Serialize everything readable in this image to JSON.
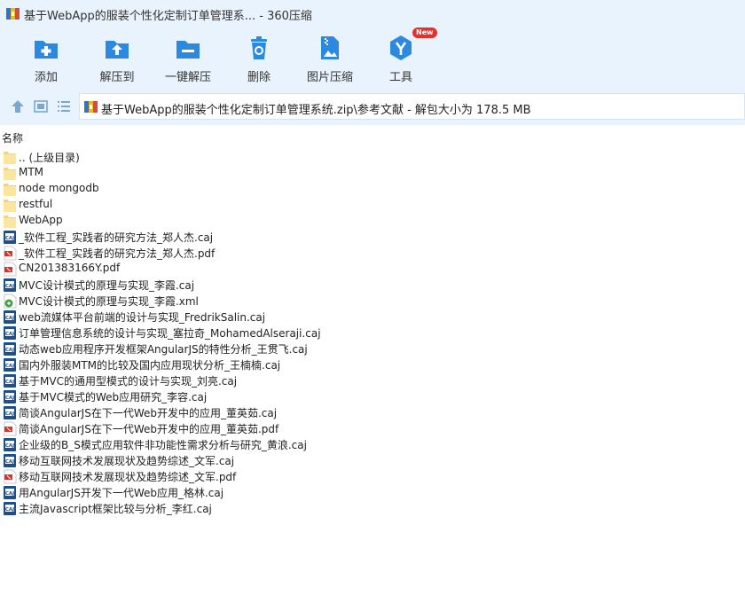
{
  "window": {
    "title": "基于WebApp的服装个性化定制订单管理系... - 360压缩"
  },
  "toolbar": {
    "tools": [
      {
        "label": "添加",
        "icon": "add-icon"
      },
      {
        "label": "解压到",
        "icon": "extract-to-icon"
      },
      {
        "label": "一键解压",
        "icon": "one-click-extract-icon"
      },
      {
        "label": "删除",
        "icon": "delete-icon"
      },
      {
        "label": "图片压缩",
        "icon": "image-compress-icon"
      },
      {
        "label": "工具",
        "icon": "tools-icon",
        "badge": "New"
      }
    ]
  },
  "nav": {
    "path": "基于WebApp的服装个性化定制订单管理系统.zip\\参考文献 - 解包大小为 178.5 MB"
  },
  "list": {
    "header": "名称",
    "items": [
      {
        "name": ".. (上级目录)",
        "type": "folder"
      },
      {
        "name": "MTM",
        "type": "folder"
      },
      {
        "name": "node mongodb",
        "type": "folder"
      },
      {
        "name": "restful",
        "type": "folder"
      },
      {
        "name": "WebApp",
        "type": "folder"
      },
      {
        "name": "_软件工程_实践者的研究方法_郑人杰.caj",
        "type": "caj"
      },
      {
        "name": "_软件工程_实践者的研究方法_郑人杰.pdf",
        "type": "pdf"
      },
      {
        "name": "CN201383166Y.pdf",
        "type": "pdf"
      },
      {
        "name": "MVC设计模式的原理与实现_李霞.caj",
        "type": "caj"
      },
      {
        "name": "MVC设计模式的原理与实现_李霞.xml",
        "type": "xml"
      },
      {
        "name": "web流媒体平台前端的设计与实现_FredrikSalin.caj",
        "type": "caj"
      },
      {
        "name": "订单管理信息系统的设计与实现_塞拉奇_MohamedAlseraji.caj",
        "type": "caj"
      },
      {
        "name": "动态web应用程序开发框架AngularJS的特性分析_王贯飞.caj",
        "type": "caj"
      },
      {
        "name": "国内外服装MTM的比较及国内应用现状分析_王楠楠.caj",
        "type": "caj"
      },
      {
        "name": "基于MVC的通用型模式的设计与实现_刘亮.caj",
        "type": "caj"
      },
      {
        "name": "基于MVC模式的Web应用研究_李容.caj",
        "type": "caj"
      },
      {
        "name": "简谈AngularJS在下一代Web开发中的应用_董英茹.caj",
        "type": "caj"
      },
      {
        "name": "简谈AngularJS在下一代Web开发中的应用_董英茹.pdf",
        "type": "pdf"
      },
      {
        "name": "企业级的B_S模式应用软件非功能性需求分析与研究_黄浪.caj",
        "type": "caj"
      },
      {
        "name": "移动互联网技术发展现状及趋势综述_文军.caj",
        "type": "caj"
      },
      {
        "name": "移动互联网技术发展现状及趋势综述_文军.pdf",
        "type": "pdf"
      },
      {
        "name": "用AngularJS开发下一代Web应用_格林.caj",
        "type": "caj"
      },
      {
        "name": "主流Javascript框架比较与分析_李红.caj",
        "type": "caj"
      }
    ]
  }
}
